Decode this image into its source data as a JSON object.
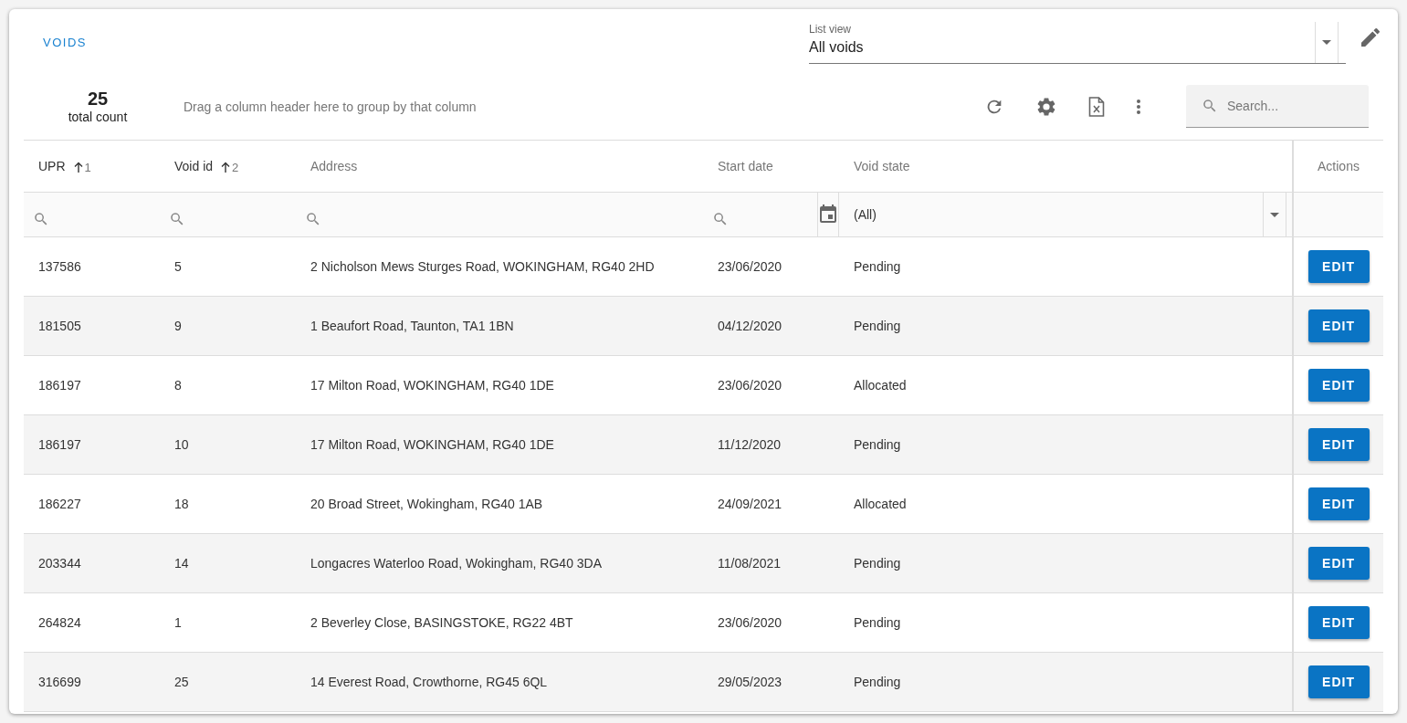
{
  "title": "VOIDS",
  "list_view": {
    "label": "List view",
    "value": "All voids"
  },
  "total": {
    "count": "25",
    "label": "total count"
  },
  "group_hint": "Drag a column header here to group by that column",
  "search": {
    "placeholder": "Search..."
  },
  "table": {
    "columns": [
      {
        "label": "UPR",
        "sorted": true,
        "sort_index": "1",
        "kind": "search"
      },
      {
        "label": "Void id",
        "sorted": true,
        "sort_index": "2",
        "kind": "search"
      },
      {
        "label": "Address",
        "sorted": false,
        "kind": "search"
      },
      {
        "label": "Start date",
        "sorted": false,
        "kind": "date"
      },
      {
        "label": "Void state",
        "sorted": false,
        "kind": "select",
        "filter_value": "(All)"
      },
      {
        "label": "Actions",
        "sorted": false,
        "kind": "actions"
      }
    ],
    "rows": [
      {
        "cells": [
          "137586",
          "5",
          "2 Nicholson Mews Sturges Road, WOKINGHAM, RG40 2HD",
          "23/06/2020",
          "Pending"
        ],
        "action": "EDIT"
      },
      {
        "cells": [
          "181505",
          "9",
          "1 Beaufort Road, Taunton, TA1 1BN",
          "04/12/2020",
          "Pending"
        ],
        "action": "EDIT"
      },
      {
        "cells": [
          "186197",
          "8",
          "17 Milton Road, WOKINGHAM, RG40 1DE",
          "23/06/2020",
          "Allocated"
        ],
        "action": "EDIT"
      },
      {
        "cells": [
          "186197",
          "10",
          "17 Milton Road, WOKINGHAM, RG40 1DE",
          "11/12/2020",
          "Pending"
        ],
        "action": "EDIT"
      },
      {
        "cells": [
          "186227",
          "18",
          "20 Broad Street, Wokingham, RG40 1AB",
          "24/09/2021",
          "Allocated"
        ],
        "action": "EDIT"
      },
      {
        "cells": [
          "203344",
          "14",
          "Longacres Waterloo Road, Wokingham, RG40 3DA",
          "11/08/2021",
          "Pending"
        ],
        "action": "EDIT"
      },
      {
        "cells": [
          "264824",
          "1",
          "2 Beverley Close, BASINGSTOKE, RG22 4BT",
          "23/06/2020",
          "Pending"
        ],
        "action": "EDIT"
      },
      {
        "cells": [
          "316699",
          "25",
          "14 Everest Road, Crowthorne, RG45 6QL",
          "29/05/2023",
          "Pending"
        ],
        "action": "EDIT"
      }
    ]
  }
}
